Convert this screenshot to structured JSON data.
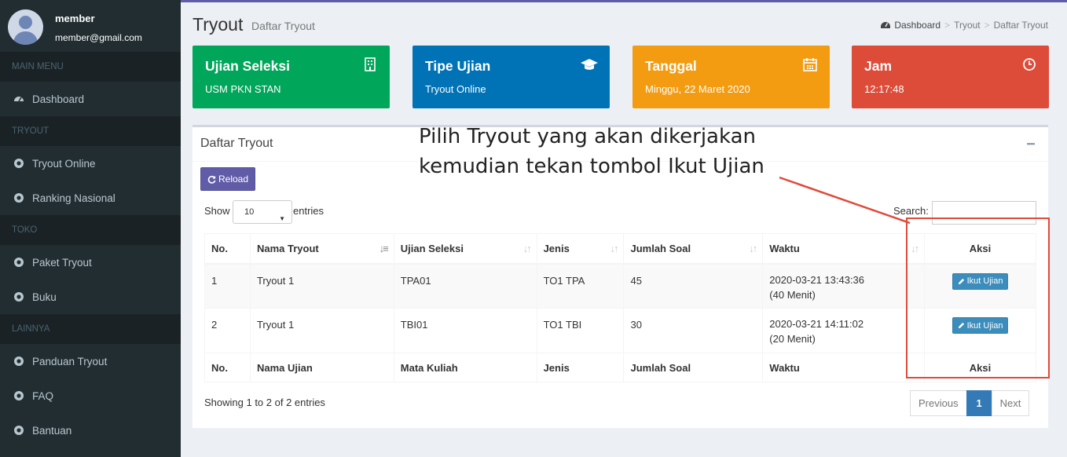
{
  "user": {
    "name": "member",
    "email": "member@gmail.com"
  },
  "sidebar": {
    "sections": [
      {
        "header": "MAIN MENU",
        "items": [
          {
            "label": "Dashboard",
            "icon": "dashboard-icon"
          }
        ]
      },
      {
        "header": "TRYOUT",
        "items": [
          {
            "label": "Tryout Online",
            "icon": "chrome-icon"
          },
          {
            "label": "Ranking Nasional",
            "icon": "chrome-icon"
          }
        ]
      },
      {
        "header": "TOKO",
        "items": [
          {
            "label": "Paket Tryout",
            "icon": "chrome-icon"
          },
          {
            "label": "Buku",
            "icon": "chrome-icon"
          }
        ]
      },
      {
        "header": "LAINNYA",
        "items": [
          {
            "label": "Panduan Tryout",
            "icon": "chrome-icon"
          },
          {
            "label": "FAQ",
            "icon": "chrome-icon"
          },
          {
            "label": "Bantuan",
            "icon": "chrome-icon"
          }
        ]
      }
    ]
  },
  "header": {
    "title": "Tryout",
    "subtitle": "Daftar Tryout",
    "breadcrumb": [
      "Dashboard",
      "Tryout",
      "Daftar Tryout"
    ]
  },
  "info_boxes": [
    {
      "title": "Ujian Seleksi",
      "value": "USM PKN STAN",
      "icon": "building-icon",
      "color": "#00a65a"
    },
    {
      "title": "Tipe Ujian",
      "value": "Tryout Online",
      "icon": "graduation-cap-icon",
      "color": "#0073b7"
    },
    {
      "title": "Tanggal",
      "value": "Minggu, 22 Maret 2020",
      "icon": "calendar-icon",
      "color": "#f39c12"
    },
    {
      "title": "Jam",
      "value": "12:17:48",
      "icon": "clock-icon",
      "color": "#dd4b39"
    }
  ],
  "box": {
    "title": "Daftar Tryout",
    "reload_label": "Reload",
    "show_label": "Show",
    "entries_value": "10",
    "entries_label": "entries",
    "search_label": "Search:",
    "search_value": ""
  },
  "table": {
    "headers": [
      "No.",
      "Nama Tryout",
      "Ujian Seleksi",
      "Jenis",
      "Jumlah Soal",
      "Waktu",
      "Aksi"
    ],
    "footers": [
      "No.",
      "Nama Ujian",
      "Mata Kuliah",
      "Jenis",
      "Jumlah Soal",
      "Waktu",
      "Aksi"
    ],
    "rows": [
      {
        "no": "1",
        "nama": "Tryout 1",
        "ujian": "TPA01",
        "jenis": "TO1 TPA",
        "jumlah": "45",
        "waktu": "2020-03-21 13:43:36",
        "durasi": "(40 Menit)",
        "aksi": "Ikut Ujian"
      },
      {
        "no": "2",
        "nama": "Tryout 1",
        "ujian": "TBI01",
        "jenis": "TO1 TBI",
        "jumlah": "30",
        "waktu": "2020-03-21 14:11:02",
        "durasi": "(20 Menit)",
        "aksi": "Ikut Ujian"
      }
    ]
  },
  "footer": {
    "showing": "Showing 1 to 2 of 2 entries",
    "previous": "Previous",
    "page": "1",
    "next": "Next"
  },
  "annotation": {
    "line1": "Pilih Tryout yang akan dikerjakan",
    "line2": "kemudian tekan tombol Ikut Ujian",
    "color": "#e04a3a"
  },
  "colors": {
    "sidebar": "#222d32",
    "accent": "#605ca8",
    "primary": "#3c8dbc"
  }
}
